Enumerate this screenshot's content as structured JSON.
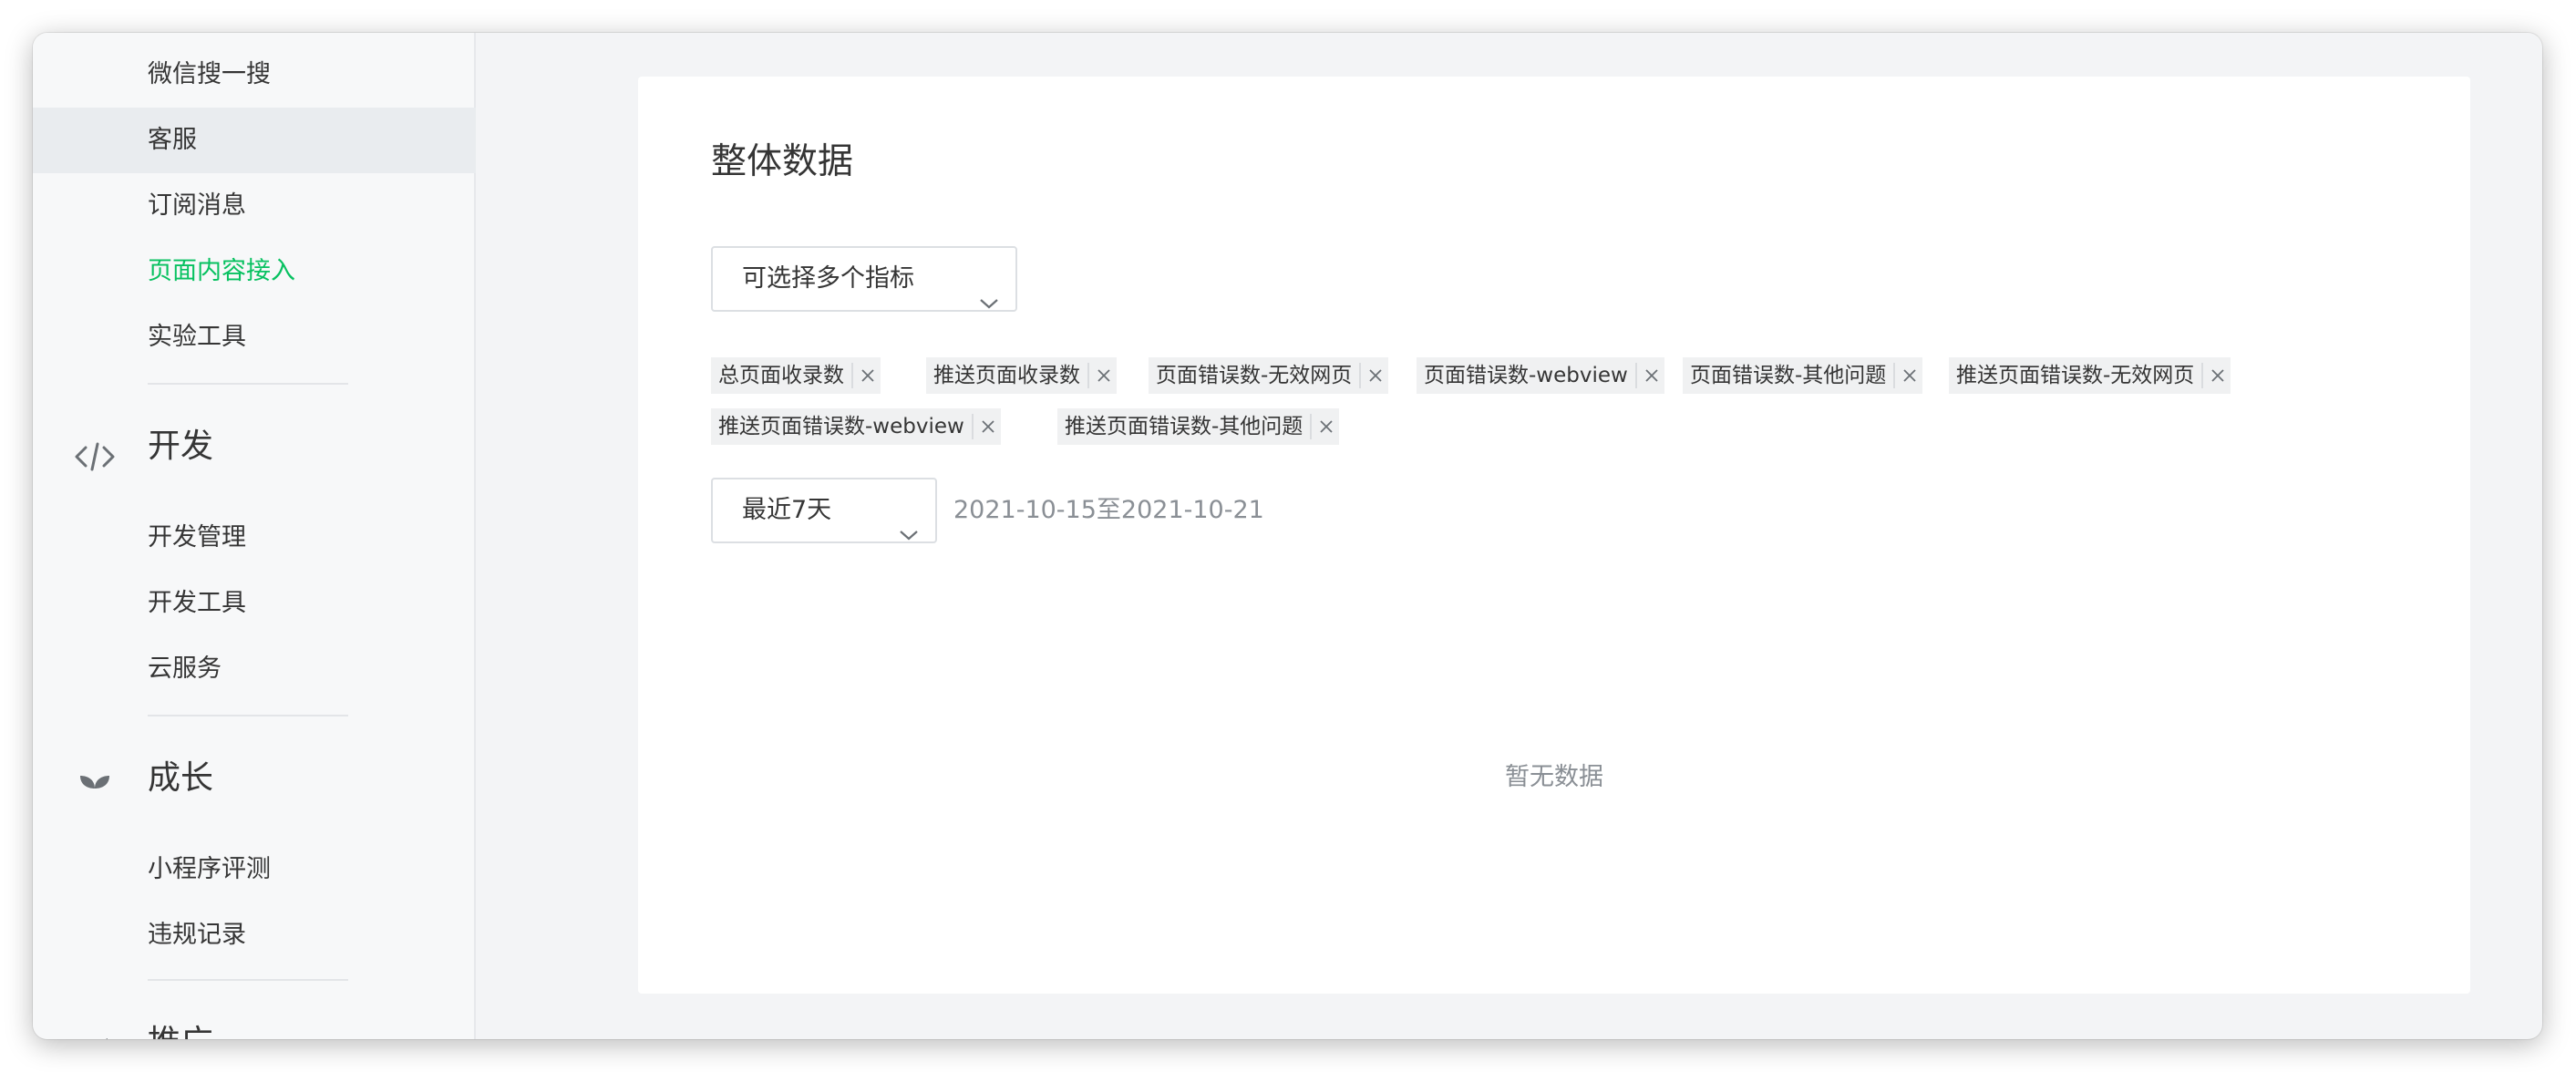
{
  "sidebar": {
    "items_top": [
      {
        "label": "微信搜一搜"
      },
      {
        "label": "客服"
      },
      {
        "label": "订阅消息"
      },
      {
        "label": "页面内容接入"
      },
      {
        "label": "实验工具"
      }
    ],
    "dev": {
      "title": "开发",
      "icon": "code-icon",
      "items": [
        {
          "label": "开发管理"
        },
        {
          "label": "开发工具"
        },
        {
          "label": "云服务"
        }
      ]
    },
    "growth": {
      "title": "成长",
      "icon": "sprout-icon",
      "items": [
        {
          "label": "小程序评测"
        },
        {
          "label": "违规记录"
        }
      ]
    },
    "promo": {
      "title": "推广",
      "icon": "megaphone-icon"
    },
    "selected_item": "客服",
    "active_item": "页面内容接入",
    "active_color": "#07c160"
  },
  "main": {
    "title": "整体数据",
    "metric_select": {
      "placeholder": "可选择多个指标"
    },
    "tags": [
      {
        "label": "总页面收录数"
      },
      {
        "label": "推送页面收录数"
      },
      {
        "label": "页面错误数-无效网页"
      },
      {
        "label": "页面错误数-webview"
      },
      {
        "label": "页面错误数-其他问题"
      },
      {
        "label": "推送页面错误数-无效网页"
      },
      {
        "label": "推送页面错误数-webview"
      },
      {
        "label": "推送页面错误数-其他问题"
      }
    ],
    "date_select": {
      "value": "最近7天"
    },
    "date_range": "2021-10-15至2021-10-21",
    "empty_text": "暂无数据"
  }
}
